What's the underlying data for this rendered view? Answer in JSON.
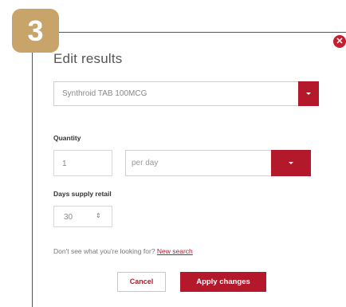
{
  "step_badge": "3",
  "modal": {
    "title": "Edit results",
    "close_icon": "close-icon"
  },
  "medication_select": {
    "value": "Synthroid TAB 100MCG",
    "icon": "chevron-down-icon"
  },
  "quantity": {
    "label": "Quantity",
    "value": "1",
    "unit_select": "per day"
  },
  "days_supply": {
    "label": "Days supply retail",
    "value": "30"
  },
  "help": {
    "text": "Don't see what you're looking for?",
    "link": "New search"
  },
  "buttons": {
    "cancel": "Cancel",
    "apply": "Apply changes"
  },
  "colors": {
    "accent": "#b3192b",
    "badge": "#c8a46a"
  }
}
